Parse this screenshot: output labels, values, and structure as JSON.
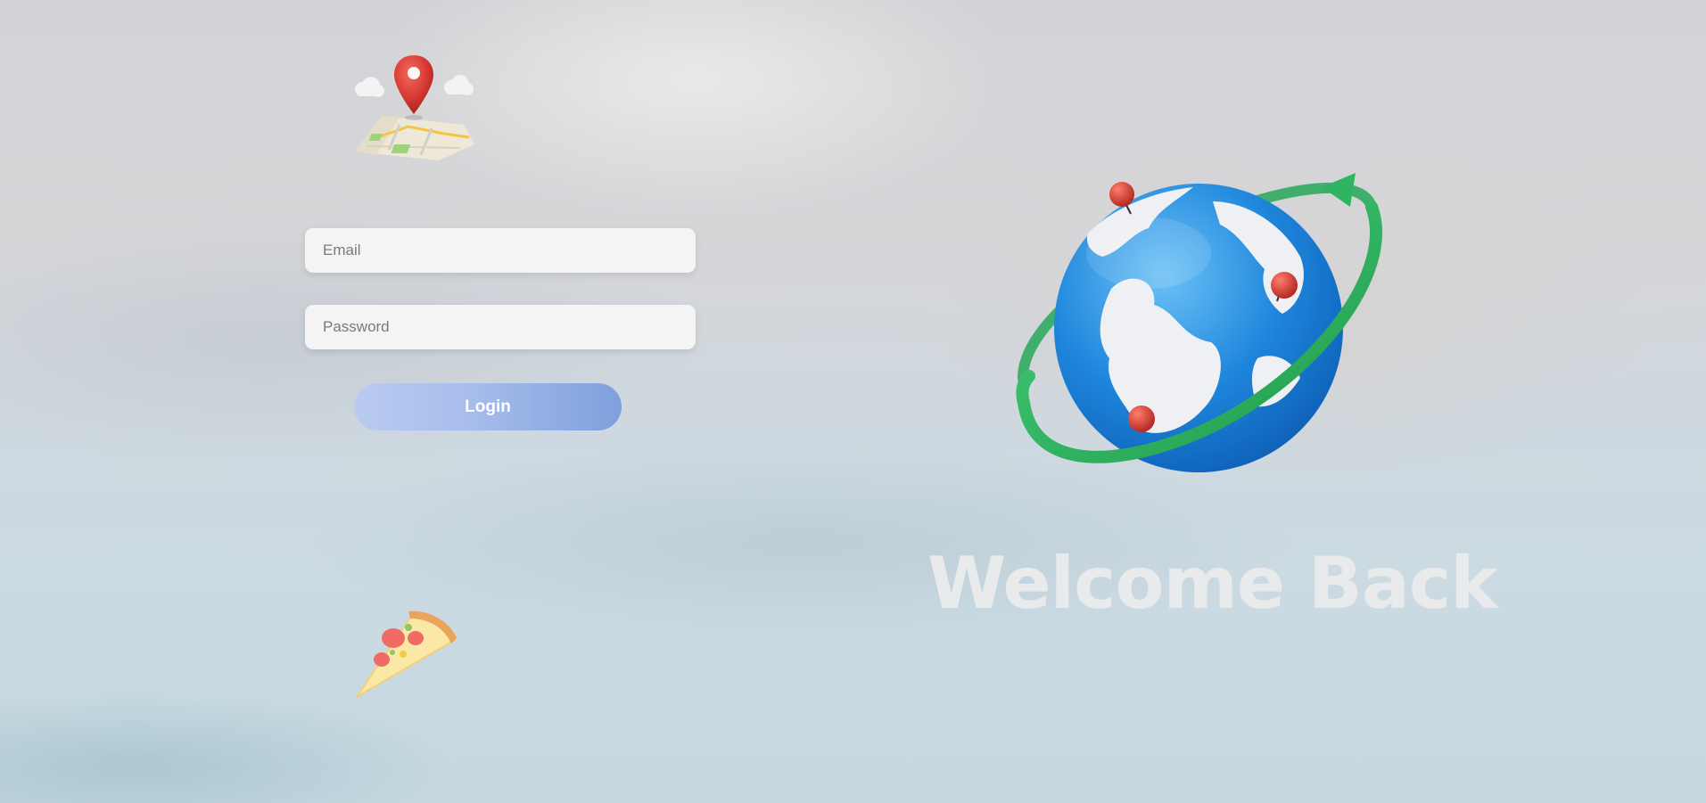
{
  "login_form": {
    "email_placeholder": "Email",
    "password_placeholder": "Password",
    "login_label": "Login"
  },
  "hero": {
    "heading": "Welcome Back"
  },
  "illustrations": {
    "top_left": "map-pin-icon",
    "bottom_left": "pizza-slice-icon",
    "right": "globe-icon"
  },
  "colors": {
    "login_gradient_start": "#bacbf1",
    "login_gradient_end": "#7f9fdc",
    "heading": "#e9eaec",
    "pin_red": "#d93a34",
    "globe_blue": "#1e86dc",
    "orbit_green": "#2fb562"
  }
}
